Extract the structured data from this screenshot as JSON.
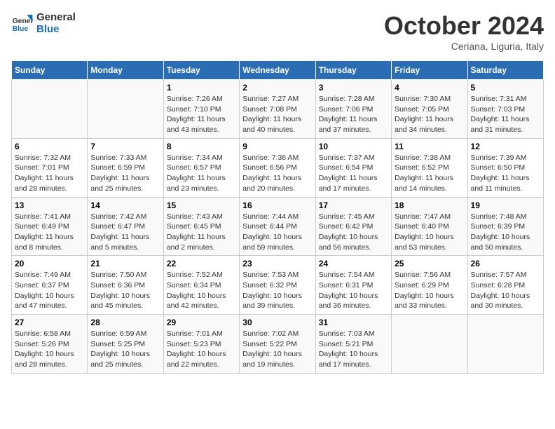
{
  "header": {
    "logo_line1": "General",
    "logo_line2": "Blue",
    "month": "October 2024",
    "location": "Ceriana, Liguria, Italy"
  },
  "days_of_week": [
    "Sunday",
    "Monday",
    "Tuesday",
    "Wednesday",
    "Thursday",
    "Friday",
    "Saturday"
  ],
  "weeks": [
    [
      {
        "day": "",
        "info": ""
      },
      {
        "day": "",
        "info": ""
      },
      {
        "day": "1",
        "info": "Sunrise: 7:26 AM\nSunset: 7:10 PM\nDaylight: 11 hours and 43 minutes."
      },
      {
        "day": "2",
        "info": "Sunrise: 7:27 AM\nSunset: 7:08 PM\nDaylight: 11 hours and 40 minutes."
      },
      {
        "day": "3",
        "info": "Sunrise: 7:28 AM\nSunset: 7:06 PM\nDaylight: 11 hours and 37 minutes."
      },
      {
        "day": "4",
        "info": "Sunrise: 7:30 AM\nSunset: 7:05 PM\nDaylight: 11 hours and 34 minutes."
      },
      {
        "day": "5",
        "info": "Sunrise: 7:31 AM\nSunset: 7:03 PM\nDaylight: 11 hours and 31 minutes."
      }
    ],
    [
      {
        "day": "6",
        "info": "Sunrise: 7:32 AM\nSunset: 7:01 PM\nDaylight: 11 hours and 28 minutes."
      },
      {
        "day": "7",
        "info": "Sunrise: 7:33 AM\nSunset: 6:59 PM\nDaylight: 11 hours and 25 minutes."
      },
      {
        "day": "8",
        "info": "Sunrise: 7:34 AM\nSunset: 6:57 PM\nDaylight: 11 hours and 23 minutes."
      },
      {
        "day": "9",
        "info": "Sunrise: 7:36 AM\nSunset: 6:56 PM\nDaylight: 11 hours and 20 minutes."
      },
      {
        "day": "10",
        "info": "Sunrise: 7:37 AM\nSunset: 6:54 PM\nDaylight: 11 hours and 17 minutes."
      },
      {
        "day": "11",
        "info": "Sunrise: 7:38 AM\nSunset: 6:52 PM\nDaylight: 11 hours and 14 minutes."
      },
      {
        "day": "12",
        "info": "Sunrise: 7:39 AM\nSunset: 6:50 PM\nDaylight: 11 hours and 11 minutes."
      }
    ],
    [
      {
        "day": "13",
        "info": "Sunrise: 7:41 AM\nSunset: 6:49 PM\nDaylight: 11 hours and 8 minutes."
      },
      {
        "day": "14",
        "info": "Sunrise: 7:42 AM\nSunset: 6:47 PM\nDaylight: 11 hours and 5 minutes."
      },
      {
        "day": "15",
        "info": "Sunrise: 7:43 AM\nSunset: 6:45 PM\nDaylight: 11 hours and 2 minutes."
      },
      {
        "day": "16",
        "info": "Sunrise: 7:44 AM\nSunset: 6:44 PM\nDaylight: 10 hours and 59 minutes."
      },
      {
        "day": "17",
        "info": "Sunrise: 7:45 AM\nSunset: 6:42 PM\nDaylight: 10 hours and 56 minutes."
      },
      {
        "day": "18",
        "info": "Sunrise: 7:47 AM\nSunset: 6:40 PM\nDaylight: 10 hours and 53 minutes."
      },
      {
        "day": "19",
        "info": "Sunrise: 7:48 AM\nSunset: 6:39 PM\nDaylight: 10 hours and 50 minutes."
      }
    ],
    [
      {
        "day": "20",
        "info": "Sunrise: 7:49 AM\nSunset: 6:37 PM\nDaylight: 10 hours and 47 minutes."
      },
      {
        "day": "21",
        "info": "Sunrise: 7:50 AM\nSunset: 6:36 PM\nDaylight: 10 hours and 45 minutes."
      },
      {
        "day": "22",
        "info": "Sunrise: 7:52 AM\nSunset: 6:34 PM\nDaylight: 10 hours and 42 minutes."
      },
      {
        "day": "23",
        "info": "Sunrise: 7:53 AM\nSunset: 6:32 PM\nDaylight: 10 hours and 39 minutes."
      },
      {
        "day": "24",
        "info": "Sunrise: 7:54 AM\nSunset: 6:31 PM\nDaylight: 10 hours and 36 minutes."
      },
      {
        "day": "25",
        "info": "Sunrise: 7:56 AM\nSunset: 6:29 PM\nDaylight: 10 hours and 33 minutes."
      },
      {
        "day": "26",
        "info": "Sunrise: 7:57 AM\nSunset: 6:28 PM\nDaylight: 10 hours and 30 minutes."
      }
    ],
    [
      {
        "day": "27",
        "info": "Sunrise: 6:58 AM\nSunset: 5:26 PM\nDaylight: 10 hours and 28 minutes."
      },
      {
        "day": "28",
        "info": "Sunrise: 6:59 AM\nSunset: 5:25 PM\nDaylight: 10 hours and 25 minutes."
      },
      {
        "day": "29",
        "info": "Sunrise: 7:01 AM\nSunset: 5:23 PM\nDaylight: 10 hours and 22 minutes."
      },
      {
        "day": "30",
        "info": "Sunrise: 7:02 AM\nSunset: 5:22 PM\nDaylight: 10 hours and 19 minutes."
      },
      {
        "day": "31",
        "info": "Sunrise: 7:03 AM\nSunset: 5:21 PM\nDaylight: 10 hours and 17 minutes."
      },
      {
        "day": "",
        "info": ""
      },
      {
        "day": "",
        "info": ""
      }
    ]
  ]
}
